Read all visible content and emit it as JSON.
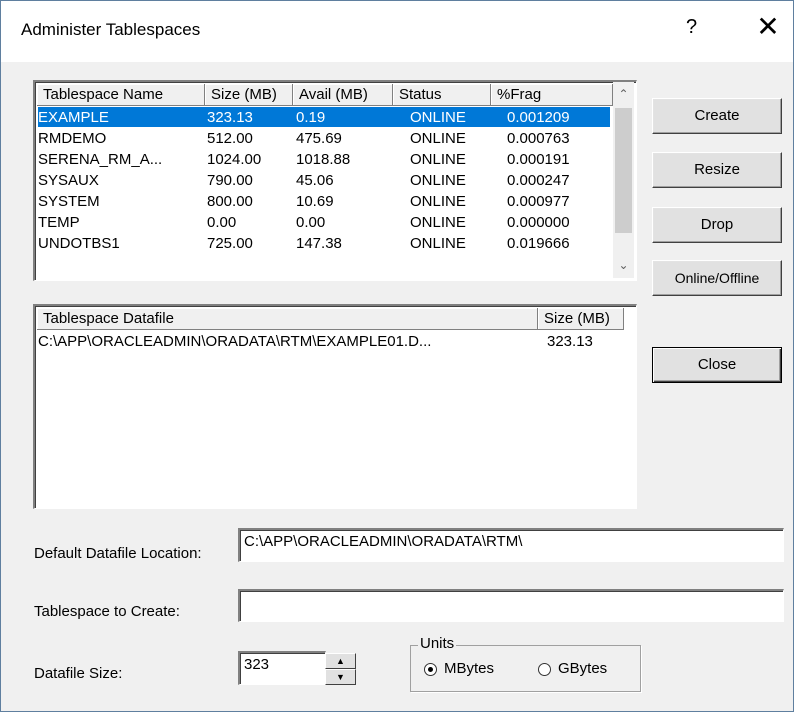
{
  "window": {
    "title": "Administer Tablespaces",
    "help_label": "?",
    "close_label": "✕"
  },
  "tablespaces": {
    "columns": [
      "Tablespace Name",
      "Size (MB)",
      "Avail (MB)",
      "Status",
      "%Frag"
    ],
    "rows": [
      [
        "EXAMPLE",
        "323.13",
        "0.19",
        "ONLINE",
        "0.001209"
      ],
      [
        "RMDEMO",
        "512.00",
        "475.69",
        "ONLINE",
        "0.000763"
      ],
      [
        "SERENA_RM_A...",
        "1024.00",
        "1018.88",
        "ONLINE",
        "0.000191"
      ],
      [
        "SYSAUX",
        "790.00",
        "45.06",
        "ONLINE",
        "0.000247"
      ],
      [
        "SYSTEM",
        "800.00",
        "10.69",
        "ONLINE",
        "0.000977"
      ],
      [
        "TEMP",
        "0.00",
        "0.00",
        "ONLINE",
        "0.000000"
      ],
      [
        "UNDOTBS1",
        "725.00",
        "147.38",
        "ONLINE",
        "0.019666"
      ]
    ],
    "selected_row": 0,
    "scroll_up_label": "⌃",
    "scroll_down_label": "⌄"
  },
  "datafiles": {
    "columns": [
      "Tablespace Datafile",
      "Size (MB)"
    ],
    "rows": [
      [
        "C:\\APP\\ORACLEADMIN\\ORADATA\\RTM\\EXAMPLE01.D...",
        "323.13"
      ]
    ]
  },
  "buttons": {
    "create": "Create",
    "resize": "Resize",
    "drop": "Drop",
    "online_offline": "Online/Offline",
    "close": "Close"
  },
  "form": {
    "default_location_label": "Default Datafile Location:",
    "default_location_value": "C:\\APP\\ORACLEADMIN\\ORADATA\\RTM\\",
    "tablespace_to_create_label": "Tablespace to Create:",
    "tablespace_to_create_value": "",
    "datafile_size_label": "Datafile Size:",
    "datafile_size_value": "323",
    "spin_up_label": "▲",
    "spin_down_label": "▼"
  },
  "units": {
    "legend": "Units",
    "options": [
      "MBytes",
      "GBytes"
    ],
    "selected": "MBytes"
  }
}
